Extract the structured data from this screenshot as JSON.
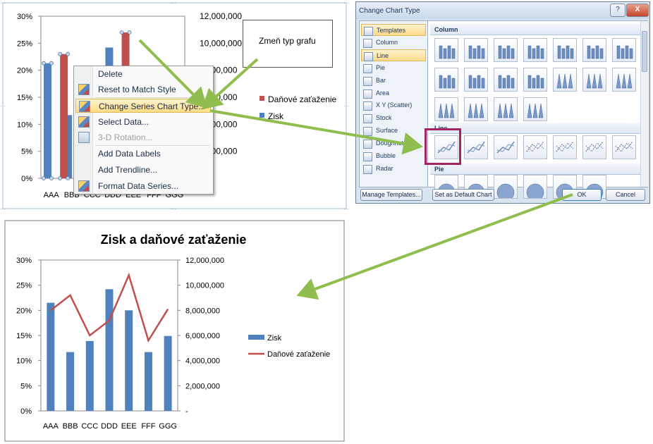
{
  "chart_data": [
    {
      "type": "bar",
      "title": "",
      "categories": [
        "AAA",
        "BBB",
        "CCC",
        "DDD",
        "EEE",
        "FFF",
        "GGG"
      ],
      "y_left_ticks": [
        "0%",
        "5%",
        "10%",
        "15%",
        "20%",
        "25%",
        "30%"
      ],
      "y_right_ticks": [
        "12,000,000",
        "10,000,000",
        "8,000,000",
        "6,000,000",
        "4,000,000",
        "2,000,000"
      ],
      "ylim_left": [
        0,
        30
      ],
      "ylim_right": [
        0,
        12000000
      ],
      "series": [
        {
          "name": "Zisk",
          "axis": "right",
          "color": "#4f81bd",
          "values": [
            21.3,
            11.7,
            13.9,
            24.2,
            20.0,
            11.7,
            14.9
          ]
        },
        {
          "name": "Daňové zaťaženie",
          "axis": "left",
          "color": "#c0504d",
          "values": [
            20.2,
            23.0,
            15.4,
            18.2,
            27.0,
            14.0,
            20.3
          ]
        }
      ],
      "legend": [
        "Daňové zaťaženie",
        "Zisk"
      ],
      "legend_position": "right"
    },
    {
      "type": "bar",
      "title": "Zisk a daňové zaťaženie",
      "categories": [
        "AAA",
        "BBB",
        "CCC",
        "DDD",
        "EEE",
        "FFF",
        "GGG"
      ],
      "y_left_ticks": [
        "0%",
        "5%",
        "10%",
        "15%",
        "20%",
        "25%",
        "30%"
      ],
      "y_right_ticks": [
        "-",
        "2,000,000",
        "4,000,000",
        "6,000,000",
        "8,000,000",
        "10,000,000",
        "12,000,000"
      ],
      "ylim_left": [
        0,
        30
      ],
      "ylim_right": [
        0,
        12000000
      ],
      "series": [
        {
          "name": "Zisk",
          "type": "bar",
          "axis": "left",
          "color": "#4f81bd",
          "values": [
            21.5,
            11.7,
            13.9,
            24.2,
            20.0,
            11.7,
            14.9
          ]
        },
        {
          "name": "Daňové zaťaženie",
          "type": "line",
          "axis": "right",
          "color": "#c0504d",
          "values": [
            8000000,
            9200000,
            6000000,
            7200000,
            10800000,
            5600000,
            8100000
          ]
        }
      ],
      "legend": [
        "Zisk",
        "Daňové zaťaženie"
      ],
      "legend_position": "right"
    }
  ],
  "context_menu": {
    "items": [
      {
        "label": "Delete",
        "icon": "",
        "disabled": false,
        "highlight": false
      },
      {
        "label": "Reset to Match Style",
        "icon": "reset-style-icon",
        "disabled": false,
        "highlight": false
      },
      {
        "label": "Change Series Chart Type...",
        "icon": "chart-type-icon",
        "disabled": false,
        "highlight": true
      },
      {
        "label": "Select Data...",
        "icon": "select-data-icon",
        "disabled": false,
        "highlight": false
      },
      {
        "label": "3-D Rotation...",
        "icon": "rotation-3d-icon",
        "disabled": true,
        "highlight": false
      },
      {
        "label": "Add Data Labels",
        "icon": "",
        "disabled": false,
        "highlight": false
      },
      {
        "label": "Add Trendline...",
        "icon": "",
        "disabled": false,
        "highlight": false
      },
      {
        "label": "Format Data Series...",
        "icon": "format-series-icon",
        "disabled": false,
        "highlight": false
      }
    ]
  },
  "callout": {
    "text": "Zmeň typ grafu"
  },
  "dialog": {
    "title": "Change Chart Type",
    "help_button": "?",
    "close_button": "X",
    "categories": [
      "Templates",
      "Column",
      "Line",
      "Pie",
      "Bar",
      "Area",
      "X Y (Scatter)",
      "Stock",
      "Surface",
      "Doughnut",
      "Bubble",
      "Radar"
    ],
    "selected_category": "Line",
    "highlighted_category": "Templates",
    "group_column": "Column",
    "group_line": "Line",
    "group_pie": "Pie",
    "manage_templates_button": "Manage Templates...",
    "set_default_button": "Set as Default Chart",
    "ok_button": "OK",
    "cancel_button": "Cancel"
  },
  "colors": {
    "accent_arrow": "#8fbe4f",
    "bar_blue": "#4f81bd",
    "series_red": "#c0504d",
    "dialog_highlight": "#a3245f"
  }
}
